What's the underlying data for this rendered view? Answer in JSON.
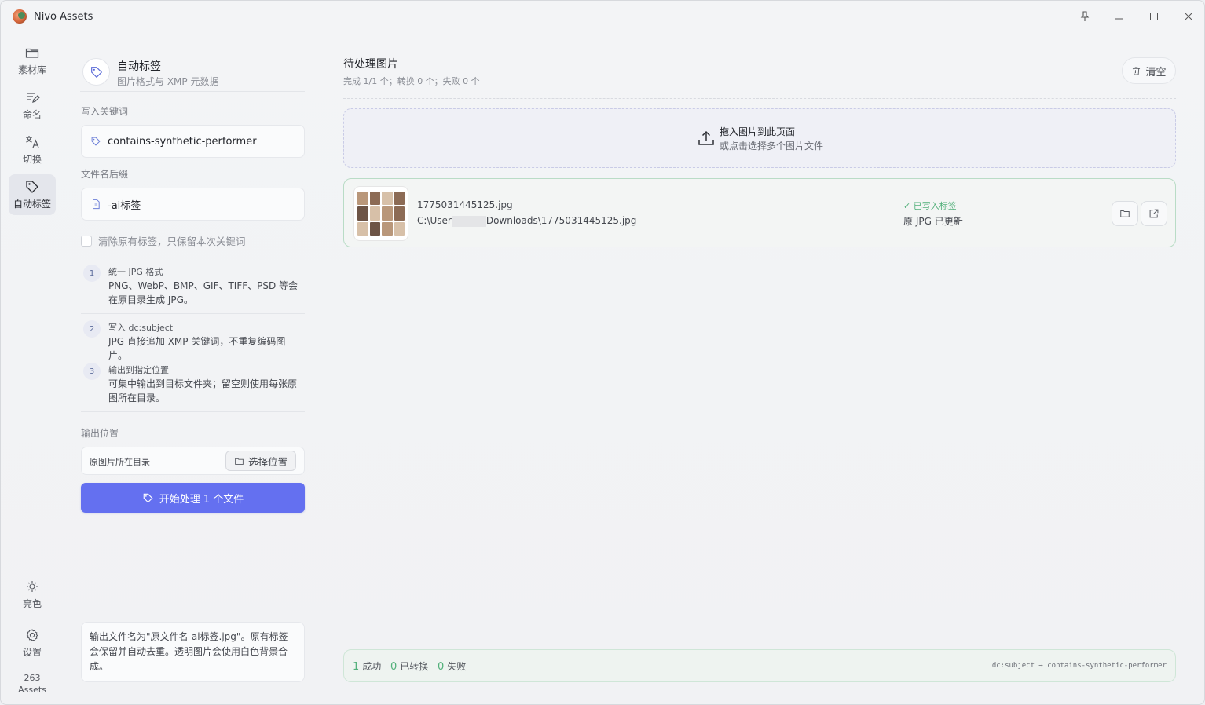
{
  "window": {
    "title": "Nivo Assets",
    "controls": [
      "pin",
      "minimize",
      "maximize",
      "close"
    ]
  },
  "rail": {
    "items": [
      {
        "label": "素材库",
        "icon": "folder-icon"
      },
      {
        "label": "命名",
        "icon": "edit-list-icon"
      },
      {
        "label": "切换",
        "icon": "translate-icon"
      },
      {
        "label": "自动标签",
        "icon": "tag-icon",
        "active": true
      }
    ],
    "theme_label": "亮色",
    "settings_label": "设置",
    "asset_count": "263",
    "asset_unit": "Assets"
  },
  "panel": {
    "title": "自动标签",
    "subtitle": "图片格式与 XMP 元数据",
    "keyword_label": "写入关键词",
    "keyword_value": "contains-synthetic-performer",
    "suffix_label": "文件名后缀",
    "suffix_value": "-ai标签",
    "clear_tags_label": "清除原有标签，只保留本次关键词",
    "steps": [
      {
        "num": "1",
        "title": "统一 JPG 格式",
        "text": "PNG、WebP、BMP、GIF、TIFF、PSD 等会在原目录生成 JPG。"
      },
      {
        "num": "2",
        "title": "写入 dc:subject",
        "text": "JPG 直接追加 XMP 关键词，不重复编码图片。"
      },
      {
        "num": "3",
        "title": "输出到指定位置",
        "text": "可集中输出到目标文件夹；留空则使用每张原图所在目录。"
      }
    ],
    "output_label": "输出位置",
    "output_value": "原图片所在目录",
    "choose_label": "选择位置",
    "start_label": "开始处理 1 个文件",
    "note": "输出文件名为\"原文件名-ai标签.jpg\"。原有标签会保留并自动去重。透明图片会使用白色背景合成。"
  },
  "main": {
    "title": "待处理图片",
    "subtitle": "完成 1/1 个；转换 0 个；失败 0 个",
    "clear_label": "清空",
    "drop_title": "拖入图片到此页面",
    "drop_sub": "或点击选择多个图片文件",
    "file": {
      "name": "1775031445125.jpg",
      "path_prefix": "C:\\User",
      "path_suffix": "Downloads\\1775031445125.jpg",
      "status": "已写入标签",
      "detail": "原 JPG 已更新"
    },
    "summary": {
      "success_n": "1",
      "success_label": "成功",
      "converted_n": "0",
      "converted_label": "已转换",
      "failed_n": "0",
      "failed_label": "失败",
      "mapping": "dc:subject → contains-synthetic-performer"
    }
  },
  "colors": {
    "accent": "#6470f0",
    "success": "#52b07a"
  }
}
